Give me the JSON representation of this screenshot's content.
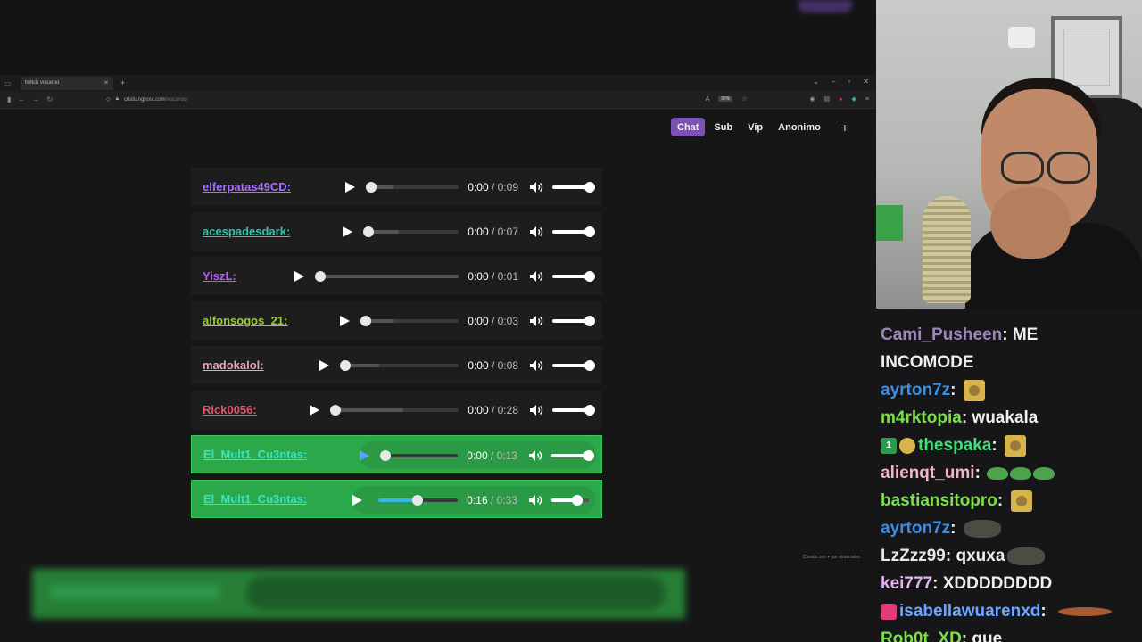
{
  "browser": {
    "tab_title": "twitch vocaroo",
    "url_domain": "cristianghost.com",
    "url_path": "/vocaroo/",
    "zoom": "90%"
  },
  "site_nav": {
    "items": [
      "Chat",
      "Sub",
      "Vip",
      "Anonimo"
    ],
    "active": "Chat",
    "add_label": "+"
  },
  "audio_rows": [
    {
      "user": "elferpatas49CD:",
      "color": "#a970ff",
      "current": "0:00",
      "duration": "/ 0:09",
      "progress": 0,
      "buffered": 0.25,
      "highlight": false,
      "seek_w": 98,
      "hl_play": false
    },
    {
      "user": "acespadesdark:",
      "color": "#2ec4a6",
      "current": "0:00",
      "duration": "/ 0:07",
      "progress": 0,
      "buffered": 0.33,
      "highlight": false,
      "seek_w": 101,
      "hl_play": false
    },
    {
      "user": "YiszL:",
      "color": "#b35cff",
      "current": "0:00",
      "duration": "/ 0:01",
      "progress": 0,
      "buffered": 1.0,
      "highlight": false,
      "seek_w": 155,
      "hl_play": false
    },
    {
      "user": "alfonsogos_21:",
      "color": "#9acd32",
      "current": "0:00",
      "duration": "/ 0:03",
      "progress": 0,
      "buffered": 0.3,
      "highlight": false,
      "seek_w": 104,
      "hl_play": false
    },
    {
      "user": "madokalol:",
      "color": "#e6a3c0",
      "current": "0:00",
      "duration": "/ 0:08",
      "progress": 0,
      "buffered": 0.3,
      "highlight": false,
      "seek_w": 127,
      "hl_play": false
    },
    {
      "user": "Rick0056:",
      "color": "#e0566e",
      "current": "0:00",
      "duration": "/ 0:28",
      "progress": 0,
      "buffered": 0.55,
      "highlight": false,
      "seek_w": 138,
      "hl_play": false
    },
    {
      "user": "El_Mult1_Cu3ntas:",
      "color": "#3ee0c8",
      "current": "0:00",
      "duration": "/ 0:13",
      "progress": 0,
      "buffered": 0.0,
      "highlight": true,
      "seek_w": 81,
      "hl_play": true
    },
    {
      "user": "El_Mult1_Cu3ntas:",
      "color": "#3ee0c8",
      "current": "0:16",
      "duration": "/ 0:33",
      "progress": 0.49,
      "buffered": 0.49,
      "highlight": true,
      "seek_w": 89,
      "hl_play": false
    }
  ],
  "credit": {
    "prefix": "Creado con",
    "suffix": "por elmarcelsc"
  },
  "chat": [
    {
      "user": "Cami_Pusheen",
      "color": "#9b86b8",
      "text": "ME"
    },
    {
      "user": "",
      "color": "#efefef",
      "text": "INCOMODE"
    },
    {
      "user": "ayrton7z",
      "color": "#3a8ee6",
      "text": "",
      "emotes": [
        "face"
      ]
    },
    {
      "user": "m4rktopia",
      "color": "#7ae04a",
      "text": "wuakala"
    },
    {
      "user": "thespaka",
      "color": "#3ee07a",
      "text": "",
      "badges": [
        "first",
        "shades"
      ],
      "emotes": [
        "face"
      ]
    },
    {
      "user": "alienqt_umi",
      "color": "#f0b4c8",
      "text": "",
      "emotes": [
        "frog",
        "frog",
        "frog"
      ]
    },
    {
      "user": "bastiansitopro",
      "color": "#7ae04a",
      "text": "",
      "emotes": [
        "face"
      ]
    },
    {
      "user": "ayrton7z",
      "color": "#3a8ee6",
      "text": "",
      "emotes": [
        "gray"
      ]
    },
    {
      "user": "LzZzz99",
      "color": "#e8e8e8",
      "text": "qxuxa",
      "emotes": [
        "gray"
      ]
    },
    {
      "user": "kei777",
      "color": "#e0b4f0",
      "text": "XDDDDDDDD"
    },
    {
      "user": "isabellawuarenxd",
      "color": "#6aa8ff",
      "text": "",
      "badges": [
        "pink"
      ],
      "emotes": [
        "dish"
      ]
    },
    {
      "user": "Rob0t_XD",
      "color": "#7ae04a",
      "text": "que"
    }
  ]
}
